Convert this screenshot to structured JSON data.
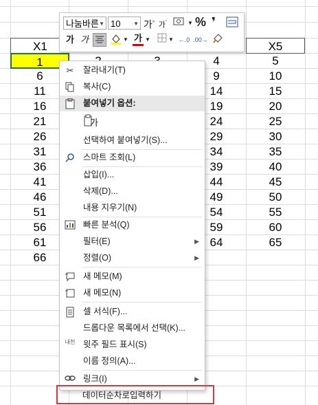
{
  "sheet": {
    "header_x1": "X1",
    "header_x5": "X5",
    "col_x1": [
      "1",
      "6",
      "11",
      "16",
      "21",
      "26",
      "31",
      "36",
      "41",
      "46",
      "51",
      "56",
      "61",
      "66"
    ],
    "col_x2_first": "2",
    "col_x3_first": "3",
    "col_x4": [
      "4",
      "9",
      "14",
      "19",
      "24",
      "29",
      "34",
      "39",
      "44",
      "49",
      "54",
      "59",
      "64"
    ],
    "col_x5": [
      "5",
      "10",
      "15",
      "20",
      "25",
      "30",
      "35",
      "40",
      "45",
      "50",
      "55",
      "60",
      "65"
    ]
  },
  "mini_toolbar": {
    "font_name": "나눔바른",
    "font_size": "10",
    "grow_font": "가",
    "shrink_font": "가",
    "bold": "가",
    "italic": "가",
    "percent": "%",
    "comma": "❜",
    "font_color_letter": "가"
  },
  "context_menu": {
    "items": [
      {
        "label": "잘라내기(T)",
        "icon": "scissors-icon"
      },
      {
        "label": "복사(C)",
        "icon": "copy-icon"
      },
      {
        "label": "붙여넣기 옵션:",
        "icon": "paste-icon"
      },
      {
        "label": "가",
        "icon": "paste-text-icon"
      },
      {
        "label": "선택하여 붙여넣기(S)...",
        "icon": ""
      },
      {
        "label": "스마트 조회(L)",
        "icon": "search-icon"
      },
      {
        "label": "삽입(I)...",
        "icon": ""
      },
      {
        "label": "삭제(D)...",
        "icon": ""
      },
      {
        "label": "내용 지우기(N)",
        "icon": ""
      },
      {
        "label": "빠른 분석(Q)",
        "icon": "quick-analysis-icon"
      },
      {
        "label": "필터(E)",
        "icon": ""
      },
      {
        "label": "정렬(O)",
        "icon": ""
      },
      {
        "label": "새 메모(M)",
        "icon": "new-comment-icon"
      },
      {
        "label": "새 메모(N)",
        "icon": "new-note-icon"
      },
      {
        "label": "셀 서식(F)...",
        "icon": "format-cells-icon"
      },
      {
        "label": "드롭다운 목록에서 선택(K)...",
        "icon": ""
      },
      {
        "label": "윗주 필드 표시(S)",
        "icon": "phonetic-icon"
      },
      {
        "label": "이름 정의(A)...",
        "icon": ""
      },
      {
        "label": "링크(I)",
        "icon": "link-icon"
      },
      {
        "label": "데이터순차로입력하기",
        "icon": ""
      }
    ],
    "phonetic_icon_text": "내천"
  },
  "colors": {
    "selected_cell": "#ffff00",
    "highlight_box": "#e03030",
    "grid": "#dadcdf"
  }
}
